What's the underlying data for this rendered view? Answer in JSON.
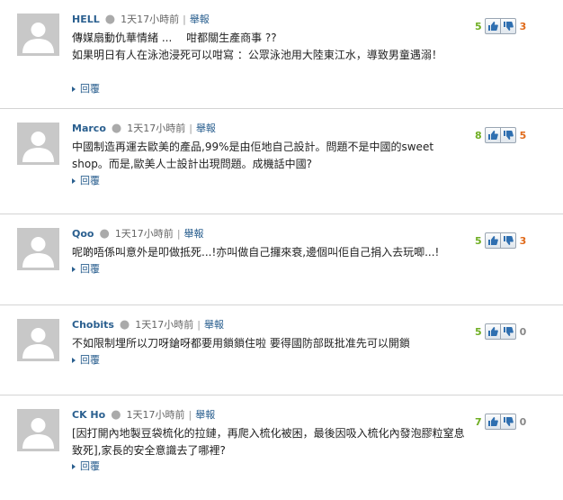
{
  "report_label": "舉報",
  "reply_label": "回覆",
  "comments": [
    {
      "author": "HELL",
      "time": "1天17小時前",
      "body": "傳媒扇動仇華情緒 ...　  咁都關生產商事 ??\n如果明日有人在泳池浸死可以咁寫 ：公眾泳池用大陸東江水，導致男童遇溺！",
      "up": "5",
      "down": "3"
    },
    {
      "author": "Marco",
      "time": "1天17小時前",
      "body": "中國制造再運去歐美的產品,99%是由佢地自己設計。問題不是中國的sweet shop。而是,歐美人士設計出現問題。成機話中國?",
      "up": "8",
      "down": "5"
    },
    {
      "author": "Qoo",
      "time": "1天17小時前",
      "body": "呢啲唔係叫意外是叩做抵死...!亦叫做自己攞來衰,邊個叫佢自己捐入去玩唧...!",
      "up": "5",
      "down": "3"
    },
    {
      "author": "Chobits",
      "time": "1天17小時前",
      "body": "不如限制埋所以刀呀鎗呀都要用鎖鎖住啦 要得國防部既批准先可以開鎖",
      "up": "5",
      "down": "0"
    },
    {
      "author": "CK Ho",
      "time": "1天17小時前",
      "body": "[因打開內地製豆袋梳化的拉鏈，再爬入梳化被困，最後因吸入梳化內發泡膠粒窒息致死],家長的安全意識去了哪裡?",
      "up": "7",
      "down": "0"
    }
  ]
}
